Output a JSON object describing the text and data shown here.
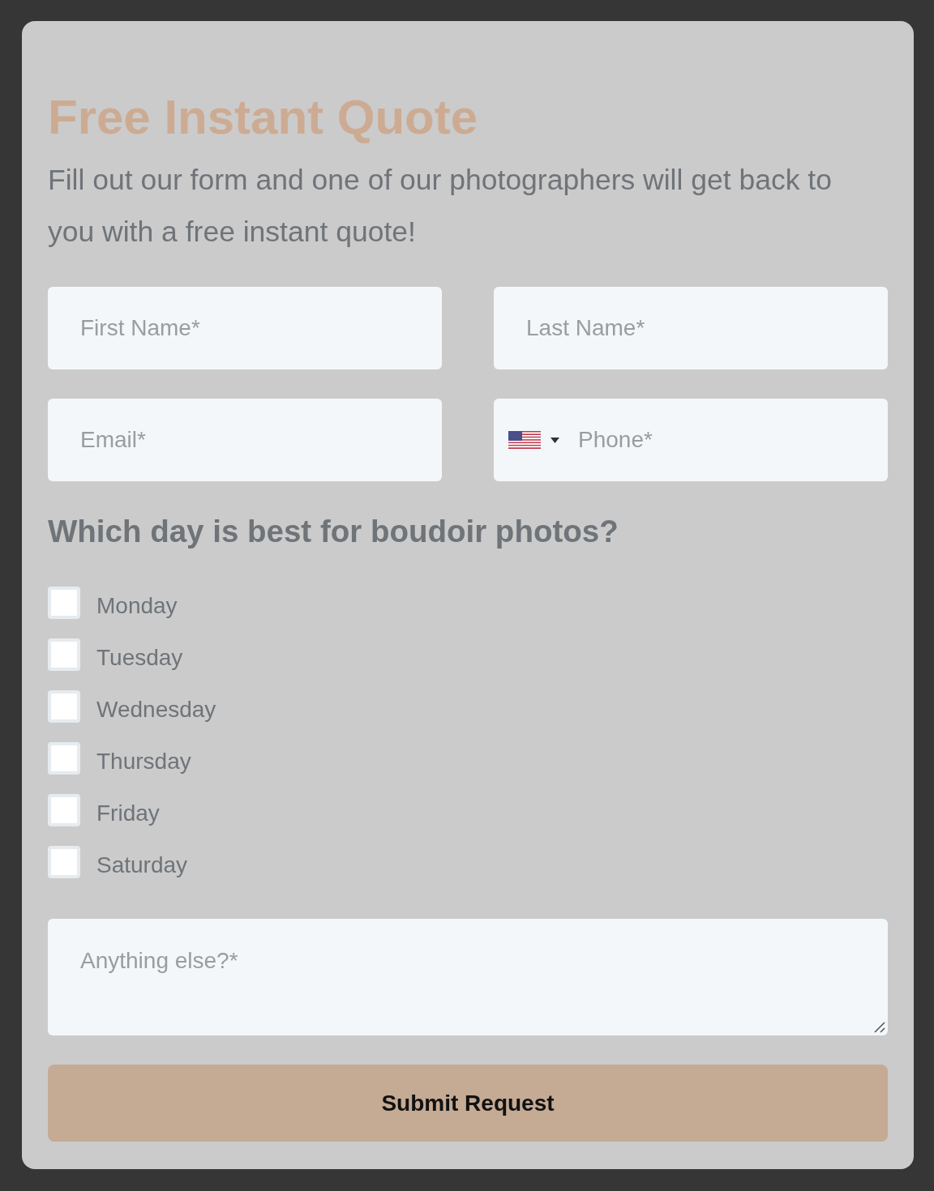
{
  "form": {
    "title": "Free Instant Quote",
    "subtitle": "Fill out our form and one of our photographers will get back to you with a free instant quote!",
    "fields": [
      {
        "kind": "text",
        "placeholder": "First Name*"
      },
      {
        "kind": "text",
        "placeholder": "Last Name*"
      },
      {
        "kind": "text",
        "placeholder": "Email*"
      },
      {
        "kind": "phone",
        "placeholder": "Phone*"
      }
    ],
    "question": "Which day is best for boudoir photos?",
    "days": [
      {
        "label": "Monday",
        "checked": false
      },
      {
        "label": "Tuesday",
        "checked": false
      },
      {
        "label": "Wednesday",
        "checked": false
      },
      {
        "label": "Thursday",
        "checked": false
      },
      {
        "label": "Friday",
        "checked": false
      },
      {
        "label": "Saturday",
        "checked": false
      }
    ],
    "message": {
      "placeholder": "Anything else?*"
    },
    "submit": {
      "label": "Submit Request"
    }
  }
}
